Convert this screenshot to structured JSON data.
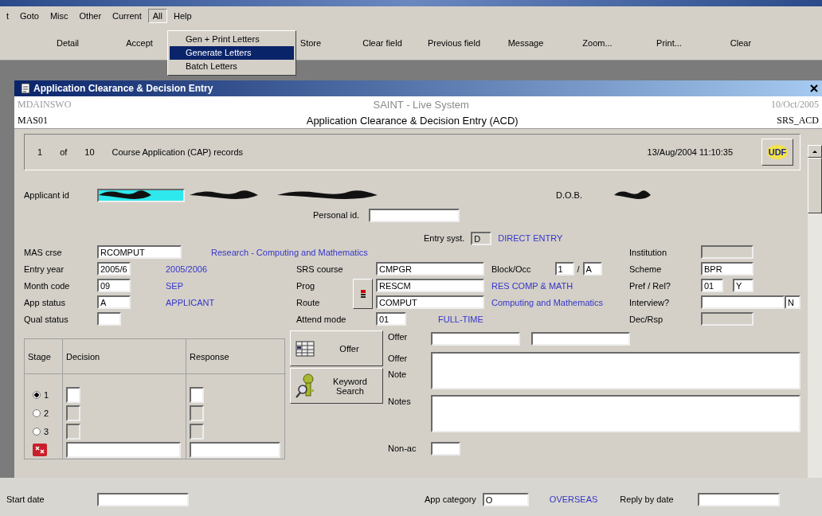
{
  "menu_bar": [
    {
      "label": "t",
      "selected": false
    },
    {
      "label": "Goto",
      "selected": false
    },
    {
      "label": "Misc",
      "selected": false
    },
    {
      "label": "Other",
      "selected": false
    },
    {
      "label": "Current",
      "selected": false
    },
    {
      "label": "All",
      "selected": true
    },
    {
      "label": "Help",
      "selected": false
    }
  ],
  "toolbar_left": [
    "Detail",
    "Accept"
  ],
  "toolbar_right": [
    "Store",
    "Clear field",
    "Previous field",
    "Message",
    "Zoom...",
    "Print...",
    "Clear"
  ],
  "dropdown": [
    {
      "label": "Gen + Print Letters",
      "selected": false
    },
    {
      "label": "Generate Letters",
      "selected": true
    },
    {
      "label": "Batch Letters",
      "selected": false
    }
  ],
  "window": {
    "title": "Application Clearance & Decision Entry"
  },
  "header": {
    "user": "MDAINSWO",
    "system": "SAINT - Live System",
    "date": "10/Oct/2005",
    "module": "MAS01",
    "screen_title": "Application Clearance & Decision Entry (ACD)",
    "screen_code": "SRS_ACD"
  },
  "record_bar": {
    "current": "1",
    "of": "of",
    "total": "10",
    "description": "Course Application (CAP) records",
    "timestamp": "13/Aug/2004 11:10:35",
    "udf_button": "UDF"
  },
  "applicant": {
    "label": "Applicant id",
    "dob_label": "D.O.B."
  },
  "personal_id": {
    "label": "Personal id."
  },
  "entry_system": {
    "label": "Entry syst.",
    "value": "D",
    "description": "DIRECT ENTRY"
  },
  "fields_left": [
    {
      "label": "MAS crse",
      "value": "RCOMPUT",
      "description": "Research - Computing and Mathematics"
    },
    {
      "label": "Entry year",
      "value": "2005/6",
      "description": "2005/2006"
    },
    {
      "label": "Month code",
      "value": "09",
      "description": "SEP"
    },
    {
      "label": "App status",
      "value": "A",
      "description": "APPLICANT"
    },
    {
      "label": "Qual status"
    }
  ],
  "fields_middle": [
    {
      "label": "SRS course",
      "value": "CMPGR"
    },
    {
      "label": "Prog",
      "value": "RESCM",
      "description": "RES COMP & MATH"
    },
    {
      "label": "Route",
      "value": "COMPUT",
      "description": "Computing and Mathematics"
    },
    {
      "label": "Attend mode",
      "value": "01",
      "description": "FULL-TIME"
    }
  ],
  "block_occ": {
    "label": "Block/Occ",
    "block": "1",
    "separator": "/",
    "occ": "A"
  },
  "institution": {
    "label": "Institution",
    "disabled": true
  },
  "scheme": {
    "label": "Scheme",
    "value": "BPR"
  },
  "pref_rel": {
    "label": "Pref / Rel?",
    "pref": "01",
    "rel": "Y"
  },
  "interview": {
    "label": "Interview?",
    "flag": "N"
  },
  "dec_rsp": {
    "label": "Dec/Rsp",
    "disabled": true
  },
  "stages": {
    "headers": [
      "Stage",
      "Decision",
      "Response"
    ],
    "rows": [
      {
        "label": "1",
        "selected": true,
        "disabled": false
      },
      {
        "label": "2",
        "selected": false,
        "disabled": true
      },
      {
        "label": "3",
        "selected": false,
        "disabled": true
      }
    ]
  },
  "offer_button": "Offer",
  "keyword_search_button": "Keyword Search",
  "offer": {
    "offer_label": "Offer",
    "text_labels": [
      "Offer",
      "Note"
    ],
    "notes_label": "Notes",
    "non_ac_label": "Non-ac"
  },
  "bottom": {
    "start_date_label": "Start date",
    "app_category": {
      "label": "App category",
      "value": "O",
      "description": "OVERSEAS"
    },
    "reply_by_date_label": "Reply by date"
  }
}
